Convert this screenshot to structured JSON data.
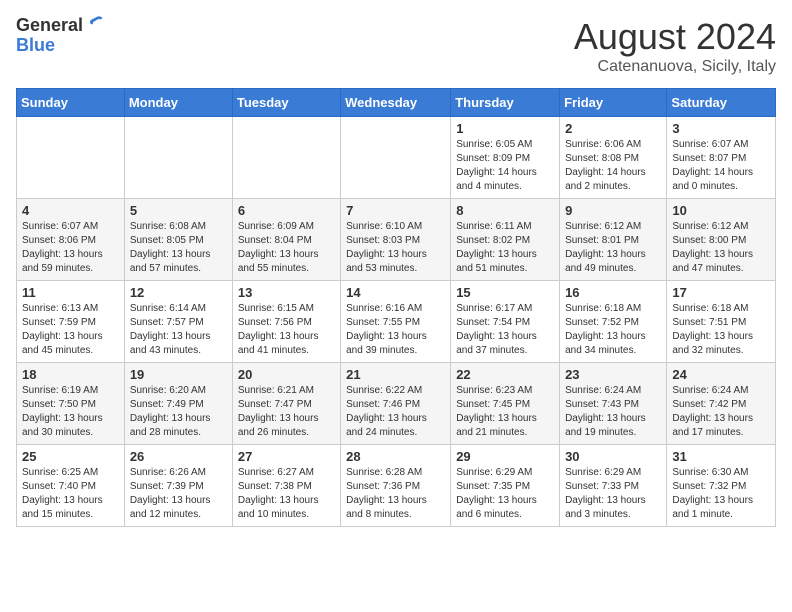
{
  "logo": {
    "general": "General",
    "blue": "Blue"
  },
  "title": "August 2024",
  "location": "Catenanuova, Sicily, Italy",
  "weekdays": [
    "Sunday",
    "Monday",
    "Tuesday",
    "Wednesday",
    "Thursday",
    "Friday",
    "Saturday"
  ],
  "weeks": [
    [
      {
        "day": "",
        "info": ""
      },
      {
        "day": "",
        "info": ""
      },
      {
        "day": "",
        "info": ""
      },
      {
        "day": "",
        "info": ""
      },
      {
        "day": "1",
        "info": "Sunrise: 6:05 AM\nSunset: 8:09 PM\nDaylight: 14 hours\nand 4 minutes."
      },
      {
        "day": "2",
        "info": "Sunrise: 6:06 AM\nSunset: 8:08 PM\nDaylight: 14 hours\nand 2 minutes."
      },
      {
        "day": "3",
        "info": "Sunrise: 6:07 AM\nSunset: 8:07 PM\nDaylight: 14 hours\nand 0 minutes."
      }
    ],
    [
      {
        "day": "4",
        "info": "Sunrise: 6:07 AM\nSunset: 8:06 PM\nDaylight: 13 hours\nand 59 minutes."
      },
      {
        "day": "5",
        "info": "Sunrise: 6:08 AM\nSunset: 8:05 PM\nDaylight: 13 hours\nand 57 minutes."
      },
      {
        "day": "6",
        "info": "Sunrise: 6:09 AM\nSunset: 8:04 PM\nDaylight: 13 hours\nand 55 minutes."
      },
      {
        "day": "7",
        "info": "Sunrise: 6:10 AM\nSunset: 8:03 PM\nDaylight: 13 hours\nand 53 minutes."
      },
      {
        "day": "8",
        "info": "Sunrise: 6:11 AM\nSunset: 8:02 PM\nDaylight: 13 hours\nand 51 minutes."
      },
      {
        "day": "9",
        "info": "Sunrise: 6:12 AM\nSunset: 8:01 PM\nDaylight: 13 hours\nand 49 minutes."
      },
      {
        "day": "10",
        "info": "Sunrise: 6:12 AM\nSunset: 8:00 PM\nDaylight: 13 hours\nand 47 minutes."
      }
    ],
    [
      {
        "day": "11",
        "info": "Sunrise: 6:13 AM\nSunset: 7:59 PM\nDaylight: 13 hours\nand 45 minutes."
      },
      {
        "day": "12",
        "info": "Sunrise: 6:14 AM\nSunset: 7:57 PM\nDaylight: 13 hours\nand 43 minutes."
      },
      {
        "day": "13",
        "info": "Sunrise: 6:15 AM\nSunset: 7:56 PM\nDaylight: 13 hours\nand 41 minutes."
      },
      {
        "day": "14",
        "info": "Sunrise: 6:16 AM\nSunset: 7:55 PM\nDaylight: 13 hours\nand 39 minutes."
      },
      {
        "day": "15",
        "info": "Sunrise: 6:17 AM\nSunset: 7:54 PM\nDaylight: 13 hours\nand 37 minutes."
      },
      {
        "day": "16",
        "info": "Sunrise: 6:18 AM\nSunset: 7:52 PM\nDaylight: 13 hours\nand 34 minutes."
      },
      {
        "day": "17",
        "info": "Sunrise: 6:18 AM\nSunset: 7:51 PM\nDaylight: 13 hours\nand 32 minutes."
      }
    ],
    [
      {
        "day": "18",
        "info": "Sunrise: 6:19 AM\nSunset: 7:50 PM\nDaylight: 13 hours\nand 30 minutes."
      },
      {
        "day": "19",
        "info": "Sunrise: 6:20 AM\nSunset: 7:49 PM\nDaylight: 13 hours\nand 28 minutes."
      },
      {
        "day": "20",
        "info": "Sunrise: 6:21 AM\nSunset: 7:47 PM\nDaylight: 13 hours\nand 26 minutes."
      },
      {
        "day": "21",
        "info": "Sunrise: 6:22 AM\nSunset: 7:46 PM\nDaylight: 13 hours\nand 24 minutes."
      },
      {
        "day": "22",
        "info": "Sunrise: 6:23 AM\nSunset: 7:45 PM\nDaylight: 13 hours\nand 21 minutes."
      },
      {
        "day": "23",
        "info": "Sunrise: 6:24 AM\nSunset: 7:43 PM\nDaylight: 13 hours\nand 19 minutes."
      },
      {
        "day": "24",
        "info": "Sunrise: 6:24 AM\nSunset: 7:42 PM\nDaylight: 13 hours\nand 17 minutes."
      }
    ],
    [
      {
        "day": "25",
        "info": "Sunrise: 6:25 AM\nSunset: 7:40 PM\nDaylight: 13 hours\nand 15 minutes."
      },
      {
        "day": "26",
        "info": "Sunrise: 6:26 AM\nSunset: 7:39 PM\nDaylight: 13 hours\nand 12 minutes."
      },
      {
        "day": "27",
        "info": "Sunrise: 6:27 AM\nSunset: 7:38 PM\nDaylight: 13 hours\nand 10 minutes."
      },
      {
        "day": "28",
        "info": "Sunrise: 6:28 AM\nSunset: 7:36 PM\nDaylight: 13 hours\nand 8 minutes."
      },
      {
        "day": "29",
        "info": "Sunrise: 6:29 AM\nSunset: 7:35 PM\nDaylight: 13 hours\nand 6 minutes."
      },
      {
        "day": "30",
        "info": "Sunrise: 6:29 AM\nSunset: 7:33 PM\nDaylight: 13 hours\nand 3 minutes."
      },
      {
        "day": "31",
        "info": "Sunrise: 6:30 AM\nSunset: 7:32 PM\nDaylight: 13 hours\nand 1 minute."
      }
    ]
  ]
}
